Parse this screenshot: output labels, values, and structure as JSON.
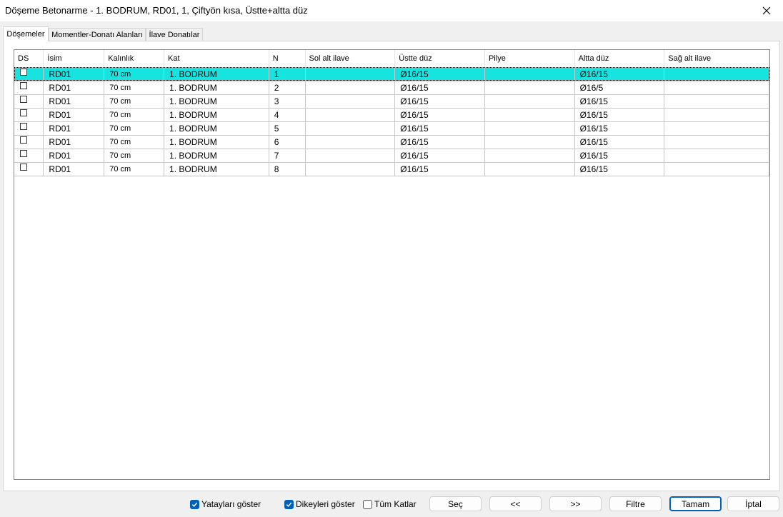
{
  "window": {
    "title": "Döşeme Betonarme - 1. BODRUM, RD01, 1, Çiftyön kısa, Üstte+altta düz"
  },
  "tabs": [
    {
      "label": "Döşemeler",
      "active": true
    },
    {
      "label": "Momentler-Donatı Alanları",
      "active": false
    },
    {
      "label": "İlave Donatılar",
      "active": false
    }
  ],
  "grid": {
    "columns": [
      "DS",
      "İsim",
      "Kalınlık",
      "Kat",
      "N",
      "Sol alt ilave",
      "Üstte düz",
      "Pilye",
      "Altta düz",
      "Sağ alt ilave"
    ],
    "rows": [
      {
        "ds": false,
        "isim": "RD01",
        "kalinlik": "70 cm",
        "kat": "1. BODRUM",
        "n": "1",
        "sol_alt_ilave": "",
        "ustte_duz": "Ø16/15",
        "pilye": "",
        "altta_duz": "Ø16/15",
        "sag_alt_ilave": "",
        "selected": true
      },
      {
        "ds": false,
        "isim": "RD01",
        "kalinlik": "70 cm",
        "kat": "1. BODRUM",
        "n": "2",
        "sol_alt_ilave": "",
        "ustte_duz": "Ø16/15",
        "pilye": "",
        "altta_duz": "Ø16/5",
        "sag_alt_ilave": "",
        "selected": false
      },
      {
        "ds": false,
        "isim": "RD01",
        "kalinlik": "70 cm",
        "kat": "1. BODRUM",
        "n": "3",
        "sol_alt_ilave": "",
        "ustte_duz": "Ø16/15",
        "pilye": "",
        "altta_duz": "Ø16/15",
        "sag_alt_ilave": "",
        "selected": false
      },
      {
        "ds": false,
        "isim": "RD01",
        "kalinlik": "70 cm",
        "kat": "1. BODRUM",
        "n": "4",
        "sol_alt_ilave": "",
        "ustte_duz": "Ø16/15",
        "pilye": "",
        "altta_duz": "Ø16/15",
        "sag_alt_ilave": "",
        "selected": false
      },
      {
        "ds": false,
        "isim": "RD01",
        "kalinlik": "70 cm",
        "kat": "1. BODRUM",
        "n": "5",
        "sol_alt_ilave": "",
        "ustte_duz": "Ø16/15",
        "pilye": "",
        "altta_duz": "Ø16/15",
        "sag_alt_ilave": "",
        "selected": false
      },
      {
        "ds": false,
        "isim": "RD01",
        "kalinlik": "70 cm",
        "kat": "1. BODRUM",
        "n": "6",
        "sol_alt_ilave": "",
        "ustte_duz": "Ø16/15",
        "pilye": "",
        "altta_duz": "Ø16/15",
        "sag_alt_ilave": "",
        "selected": false
      },
      {
        "ds": false,
        "isim": "RD01",
        "kalinlik": "70 cm",
        "kat": "1. BODRUM",
        "n": "7",
        "sol_alt_ilave": "",
        "ustte_duz": "Ø16/15",
        "pilye": "",
        "altta_duz": "Ø16/15",
        "sag_alt_ilave": "",
        "selected": false
      },
      {
        "ds": false,
        "isim": "RD01",
        "kalinlik": "70 cm",
        "kat": "1. BODRUM",
        "n": "8",
        "sol_alt_ilave": "",
        "ustte_duz": "Ø16/15",
        "pilye": "",
        "altta_duz": "Ø16/15",
        "sag_alt_ilave": "",
        "selected": false
      }
    ]
  },
  "options": {
    "yataylari_goster": {
      "label": "Yatayları göster",
      "checked": true
    },
    "dikeyleri_goster": {
      "label": "Dikeyleri göster",
      "checked": true
    },
    "tum_katlar": {
      "label": "Tüm Katlar",
      "checked": false
    }
  },
  "buttons": {
    "sec": "Seç",
    "prev": "<<",
    "next": ">>",
    "filtre": "Filtre",
    "tamam": "Tamam",
    "iptal": "İptal"
  },
  "colors": {
    "selected_row": "#17e3e0",
    "accent": "#005fb8"
  },
  "icons": {
    "close": "close-icon",
    "check": "check-icon"
  }
}
